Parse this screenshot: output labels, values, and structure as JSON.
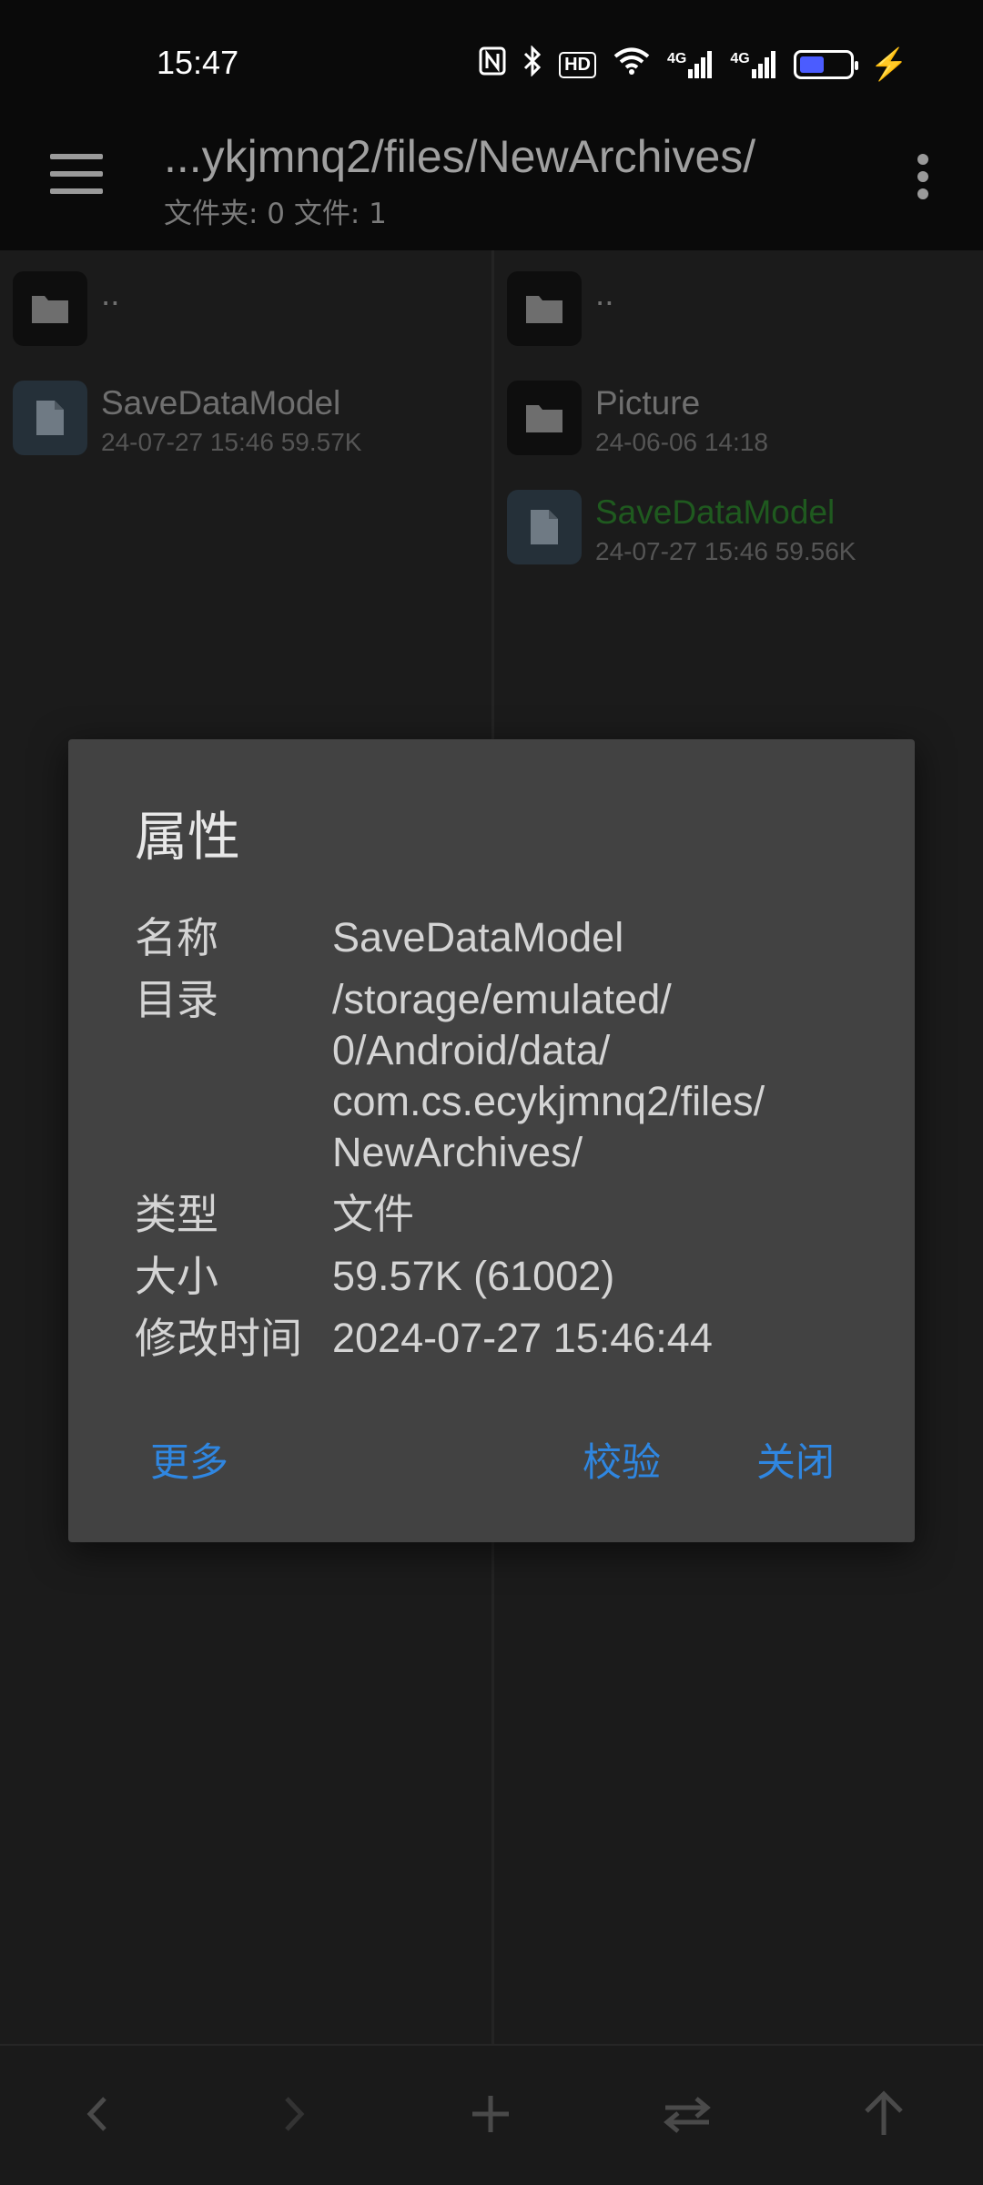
{
  "status": {
    "time": "15:47",
    "icons": [
      "nfc-icon",
      "bluetooth-icon",
      "hd-icon",
      "wifi-icon",
      "signal-4g-icon",
      "signal-4g-icon",
      "battery-icon",
      "charging-icon"
    ],
    "hd_label": "HD",
    "net1": "4G",
    "net2": "4G",
    "battery_level": 0.4
  },
  "appbar": {
    "title": "...ykjmnq2/files/NewArchives/",
    "subtitle": "文件夹: 0  文件: 1"
  },
  "left_pane": {
    "items": [
      {
        "type": "folder",
        "name": "..",
        "meta": ""
      },
      {
        "type": "file",
        "name": "SaveDataModel",
        "meta": "24-07-27 15:46  59.57K"
      }
    ]
  },
  "right_pane": {
    "items": [
      {
        "type": "folder",
        "name": "..",
        "meta": ""
      },
      {
        "type": "folder",
        "name": "Picture",
        "meta": "24-06-06 14:18"
      },
      {
        "type": "file",
        "name": "SaveDataModel",
        "meta": "24-07-27 15:46  59.56K"
      }
    ]
  },
  "dialog": {
    "title": "属性",
    "rows": {
      "name_label": "名称",
      "name_value": "SaveDataModel",
      "dir_label": "目录",
      "dir_line1": "/storage/emulated/",
      "dir_line2": "0/Android/data/",
      "dir_line3": "com.cs.ecykjmnq2/files/",
      "dir_line4": "NewArchives/",
      "type_label": "类型",
      "type_value": "文件",
      "size_label": "大小",
      "size_value": "59.57K (61002)",
      "mtime_label": "修改时间",
      "mtime_value": "2024-07-27 15:46:44"
    },
    "buttons": {
      "more": "更多",
      "verify": "校验",
      "close": "关闭"
    }
  },
  "bottombar": {
    "buttons": [
      "back-icon",
      "forward-icon",
      "add-icon",
      "swap-icon",
      "up-icon"
    ]
  },
  "colors": {
    "accent": "#2f86e0",
    "highlight_file": "#1f5a1f",
    "dialog_bg": "#424242"
  }
}
